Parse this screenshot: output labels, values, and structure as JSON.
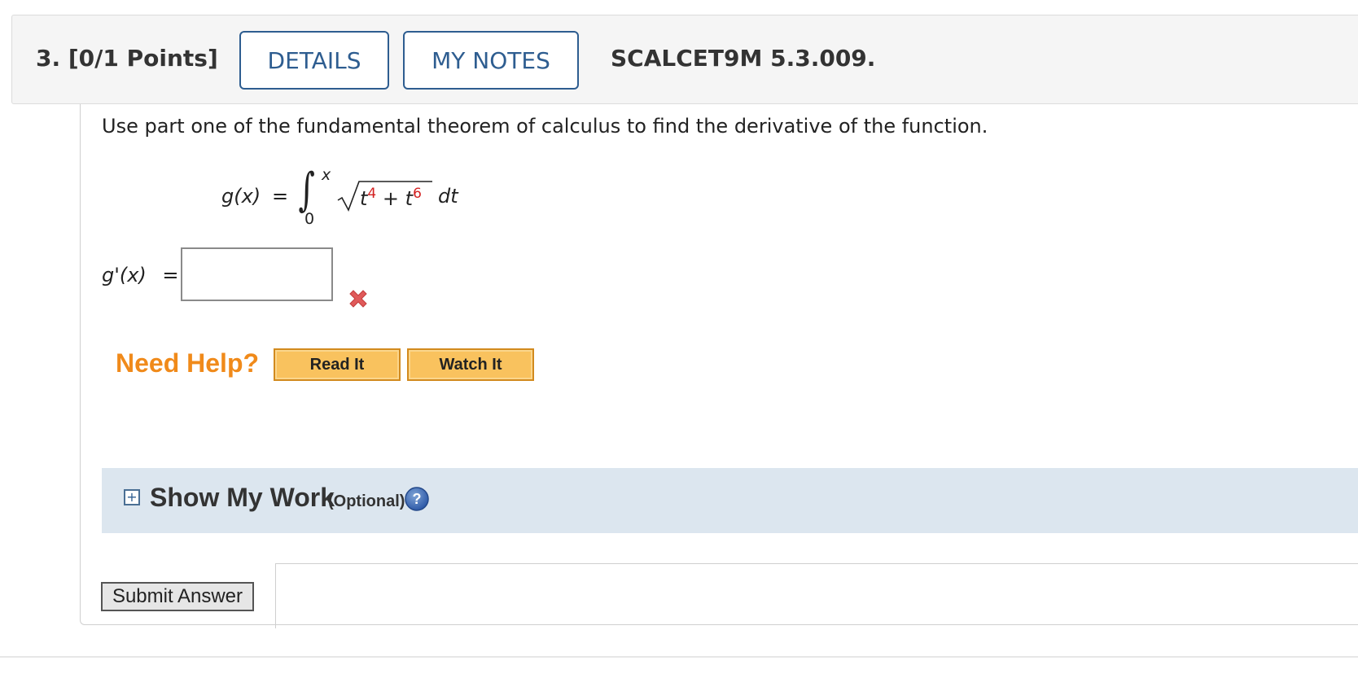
{
  "header": {
    "question_number": "3.",
    "points": "[0/1 Points]",
    "details_label": "DETAILS",
    "my_notes_label": "MY NOTES",
    "question_code": "SCALCET9M 5.3.009."
  },
  "question": {
    "prompt": "Use part one of the fundamental theorem of calculus to find the derivative of the function.",
    "formula": {
      "lhs": "g(x)",
      "equals": "=",
      "upper_limit": "x",
      "lower_limit": "0",
      "term1": "t",
      "exp1": "4",
      "plus": "+",
      "term2": "t",
      "exp2": "6",
      "differential": "dt"
    }
  },
  "answer": {
    "label": "g'(x)",
    "equals": "=",
    "value": "",
    "status": "incorrect",
    "status_color": "#e05a5a"
  },
  "help": {
    "title": "Need Help?",
    "read_it_label": "Read It",
    "watch_it_label": "Watch It"
  },
  "show_my_work": {
    "title": "Show My Work",
    "optional_label": "(Optional)"
  },
  "submit": {
    "label": "Submit Answer"
  },
  "colors": {
    "accent_blue": "#2e5d90",
    "help_orange": "#f08a1a",
    "exponent_red": "#d32020",
    "show_work_bg": "#dce6ef"
  }
}
